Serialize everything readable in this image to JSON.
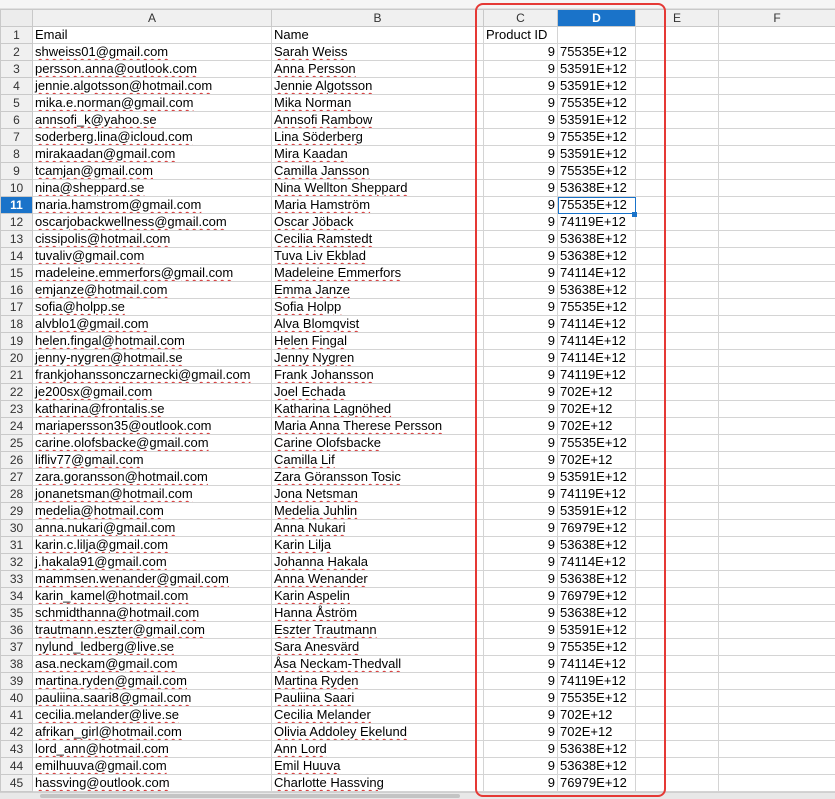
{
  "columns": [
    "A",
    "B",
    "C",
    "D",
    "E",
    "F"
  ],
  "selected_column": "D",
  "active_row": "11",
  "annotation_color": "#e53935",
  "rows": [
    {
      "n": "1",
      "a": "Email",
      "b": "Name",
      "c": "Product ID",
      "d": ""
    },
    {
      "n": "2",
      "a": "shweiss01@gmail.com",
      "b": "Sarah Weiss",
      "c": "9",
      "d": "75535E+12"
    },
    {
      "n": "3",
      "a": "persson.anna@outlook.com",
      "b": "Anna Persson",
      "c": "9",
      "d": "53591E+12"
    },
    {
      "n": "4",
      "a": "jennie.algotsson@hotmail.com",
      "b": "Jennie Algotsson",
      "c": "9",
      "d": "53591E+12"
    },
    {
      "n": "5",
      "a": "mika.e.norman@gmail.com",
      "b": "Mika Norman",
      "c": "9",
      "d": "75535E+12"
    },
    {
      "n": "6",
      "a": "annsofi_k@yahoo.se",
      "b": "Annsofi Rambow",
      "c": "9",
      "d": "53591E+12"
    },
    {
      "n": "7",
      "a": "soderberg.lina@icloud.com",
      "b": "Lina Söderberg",
      "c": "9",
      "d": "75535E+12"
    },
    {
      "n": "8",
      "a": "mirakaadan@gmail.com",
      "b": "Mira Kaadan",
      "c": "9",
      "d": "53591E+12"
    },
    {
      "n": "9",
      "a": "tcamjan@gmail.com",
      "b": "Camilla Jansson",
      "c": "9",
      "d": "75535E+12"
    },
    {
      "n": "10",
      "a": "nina@sheppard.se",
      "b": "Nina Wellton Sheppard",
      "c": "9",
      "d": "53638E+12"
    },
    {
      "n": "11",
      "a": "maria.hamstrom@gmail.com",
      "b": "Maria Hamström",
      "c": "9",
      "d": "75535E+12"
    },
    {
      "n": "12",
      "a": "oscarjobackwellness@gmail.com",
      "b": "Oscar Jöback",
      "c": "9",
      "d": "74119E+12"
    },
    {
      "n": "13",
      "a": "cissipolis@hotmail.com",
      "b": "Cecilia Ramstedt",
      "c": "9",
      "d": "53638E+12"
    },
    {
      "n": "14",
      "a": "tuvaliv@gmail.com",
      "b": "Tuva Liv Ekblad",
      "c": "9",
      "d": "53638E+12"
    },
    {
      "n": "15",
      "a": "madeleine.emmerfors@gmail.com",
      "b": "Madeleine Emmerfors",
      "c": "9",
      "d": "74114E+12"
    },
    {
      "n": "16",
      "a": "emjanze@hotmail.com",
      "b": "Emma Janze",
      "c": "9",
      "d": "53638E+12"
    },
    {
      "n": "17",
      "a": "sofia@holpp.se",
      "b": "Sofia Holpp",
      "c": "9",
      "d": "75535E+12"
    },
    {
      "n": "18",
      "a": "alvblo1@gmail.com",
      "b": "Alva Blomqvist",
      "c": "9",
      "d": "74114E+12"
    },
    {
      "n": "19",
      "a": "helen.fingal@hotmail.com",
      "b": "Helen Fingal",
      "c": "9",
      "d": "74114E+12"
    },
    {
      "n": "20",
      "a": "jenny-nygren@hotmail.se",
      "b": "Jenny Nygren",
      "c": "9",
      "d": "74114E+12"
    },
    {
      "n": "21",
      "a": "frankjohanssonczarnecki@gmail.com",
      "b": "Frank Johansson",
      "c": "9",
      "d": "74119E+12"
    },
    {
      "n": "22",
      "a": "je200sx@gmail.com",
      "b": "Joel Echada",
      "c": "9",
      "d": "702E+12"
    },
    {
      "n": "23",
      "a": "katharina@frontalis.se",
      "b": "Katharina Lagnöhed",
      "c": "9",
      "d": "702E+12"
    },
    {
      "n": "24",
      "a": "mariapersson35@outlook.com",
      "b": "Maria Anna Therese Persson",
      "c": "9",
      "d": "702E+12"
    },
    {
      "n": "25",
      "a": "carine.olofsbacke@gmail.com",
      "b": "Carine Olofsbacke",
      "c": "9",
      "d": "75535E+12"
    },
    {
      "n": "26",
      "a": "lifliv77@gmail.com",
      "b": "Camilla Lif",
      "c": "9",
      "d": "702E+12"
    },
    {
      "n": "27",
      "a": "zara.goransson@hotmail.com",
      "b": "Zara Göransson Tosic",
      "c": "9",
      "d": "53591E+12"
    },
    {
      "n": "28",
      "a": "jonanetsman@hotmail.com",
      "b": "Jona Netsman",
      "c": "9",
      "d": "74119E+12"
    },
    {
      "n": "29",
      "a": "medelia@hotmail.com",
      "b": "Medelia Juhlin",
      "c": "9",
      "d": "53591E+12"
    },
    {
      "n": "30",
      "a": "anna.nukari@gmail.com",
      "b": "Anna Nukari",
      "c": "9",
      "d": "76979E+12"
    },
    {
      "n": "31",
      "a": "karin.c.lilja@gmail.com",
      "b": "Karin Lilja",
      "c": "9",
      "d": "53638E+12"
    },
    {
      "n": "32",
      "a": "j.hakala91@gmail.com",
      "b": "Johanna Hakala",
      "c": "9",
      "d": "74114E+12"
    },
    {
      "n": "33",
      "a": "mammsen.wenander@gmail.com",
      "b": "Anna Wenander",
      "c": "9",
      "d": "53638E+12"
    },
    {
      "n": "34",
      "a": "karin_kamel@hotmail.com",
      "b": "Karin Aspelin",
      "c": "9",
      "d": "76979E+12"
    },
    {
      "n": "35",
      "a": "schmidthanna@hotmail.com",
      "b": "Hanna Åström",
      "c": "9",
      "d": "53638E+12"
    },
    {
      "n": "36",
      "a": "trautmann.eszter@gmail.com",
      "b": "Eszter Trautmann",
      "c": "9",
      "d": "53591E+12"
    },
    {
      "n": "37",
      "a": "nylund_ledberg@live.se",
      "b": "Sara Anesvärd",
      "c": "9",
      "d": "75535E+12"
    },
    {
      "n": "38",
      "a": "asa.neckam@gmail.com",
      "b": "Åsa Neckam-Thedvall",
      "c": "9",
      "d": "74114E+12"
    },
    {
      "n": "39",
      "a": "martina.ryden@gmail.com",
      "b": "Martina Ryden",
      "c": "9",
      "d": "74119E+12"
    },
    {
      "n": "40",
      "a": "pauliina.saari8@gmail.com",
      "b": "Pauliina Saari",
      "c": "9",
      "d": "75535E+12"
    },
    {
      "n": "41",
      "a": "cecilia.melander@live.se",
      "b": "Cecilia Melander",
      "c": "9",
      "d": "702E+12"
    },
    {
      "n": "42",
      "a": "afrikan_girl@hotmail.com",
      "b": "Olivia Addoley Ekelund",
      "c": "9",
      "d": "702E+12"
    },
    {
      "n": "43",
      "a": "lord_ann@hotmail.com",
      "b": "Ann Lord",
      "c": "9",
      "d": "53638E+12"
    },
    {
      "n": "44",
      "a": "emilhuuva@gmail.com",
      "b": "Emil Huuva",
      "c": "9",
      "d": "53638E+12"
    },
    {
      "n": "45",
      "a": "hassving@outlook.com",
      "b": "Charlotte Hassving",
      "c": "9",
      "d": "76979E+12"
    }
  ]
}
